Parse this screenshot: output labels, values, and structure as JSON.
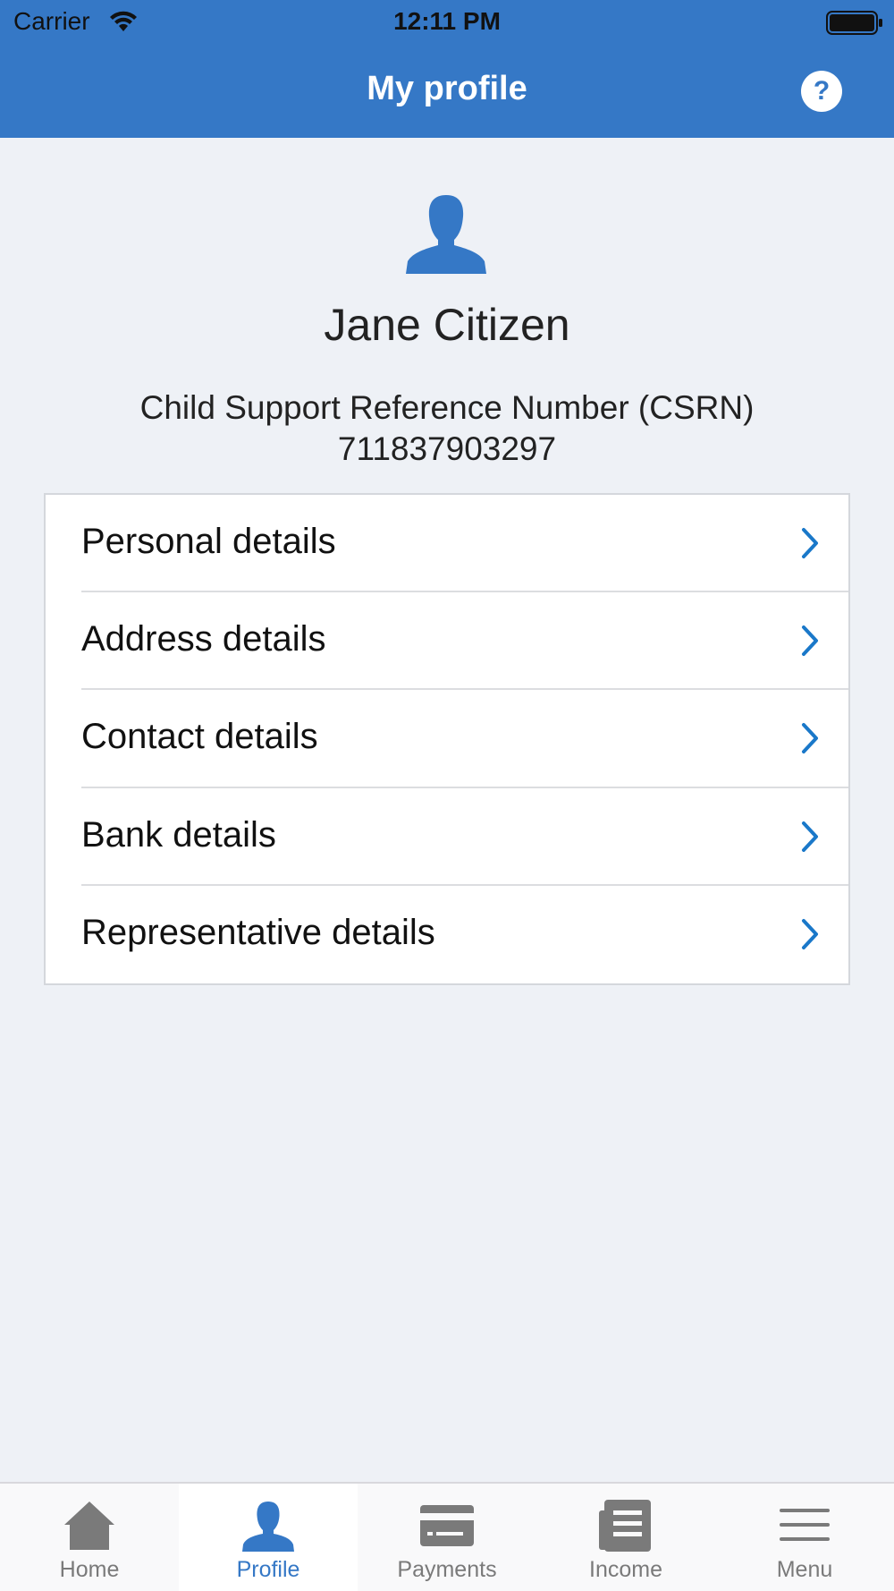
{
  "status_bar": {
    "carrier": "Carrier",
    "time": "12:11 PM"
  },
  "header": {
    "title": "My profile",
    "help_label": "?"
  },
  "profile": {
    "name": "Jane Citizen",
    "reference_label": "Child Support Reference Number (CSRN)",
    "reference_number": "711837903297"
  },
  "details": [
    {
      "label": "Personal details"
    },
    {
      "label": "Address details"
    },
    {
      "label": "Contact details"
    },
    {
      "label": "Bank details"
    },
    {
      "label": "Representative details"
    }
  ],
  "tabs": [
    {
      "label": "Home",
      "icon": "home-icon"
    },
    {
      "label": "Profile",
      "icon": "profile-icon",
      "active": true
    },
    {
      "label": "Payments",
      "icon": "payments-icon"
    },
    {
      "label": "Income",
      "icon": "income-icon"
    },
    {
      "label": "Menu",
      "icon": "menu-icon"
    }
  ],
  "colors": {
    "accent": "#3578c6",
    "background": "#eef1f6",
    "chevron": "#1a78c9",
    "tab_inactive": "#7a7a7a"
  }
}
